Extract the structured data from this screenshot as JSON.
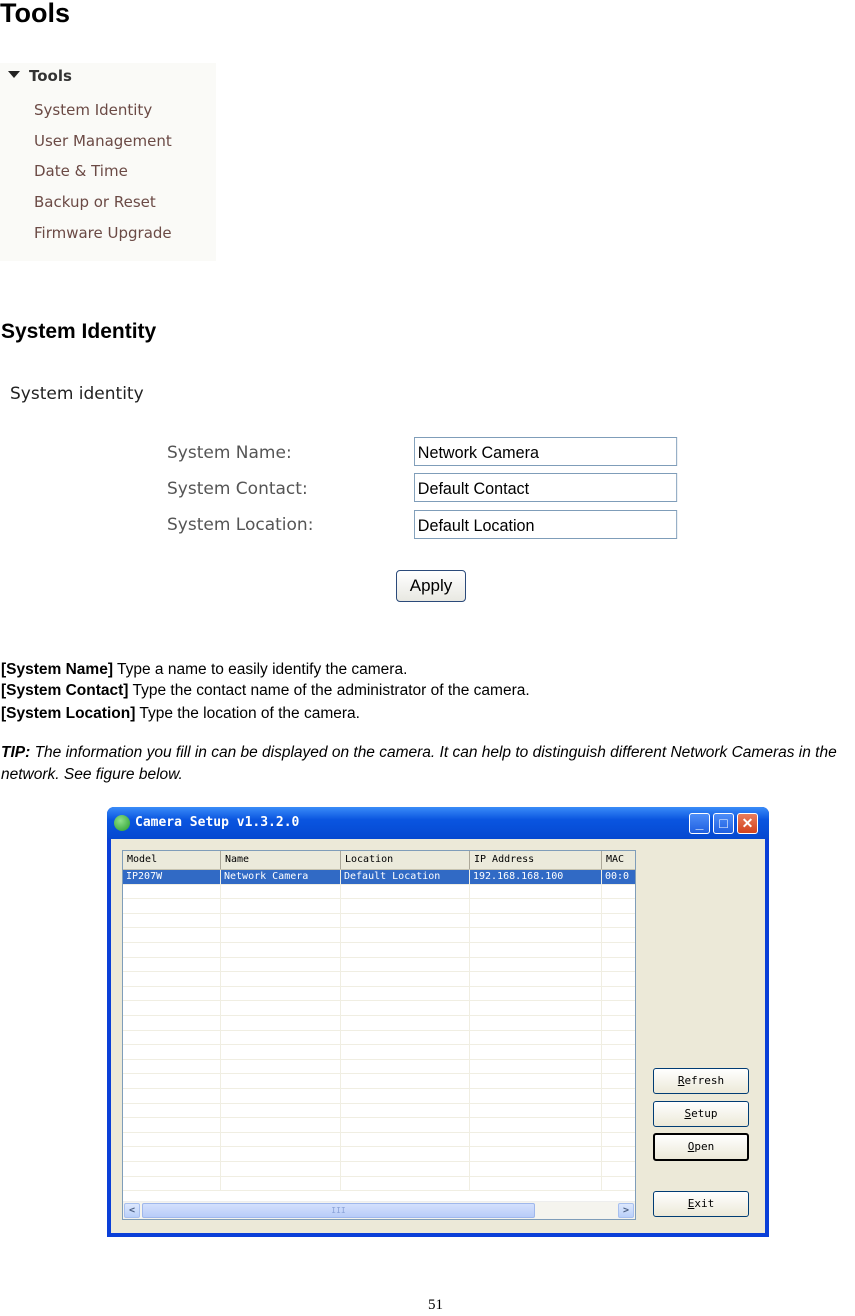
{
  "heading_tools": "Tools",
  "nav": {
    "header": "Tools",
    "items": [
      "System Identity",
      "User Management",
      "Date & Time",
      "Backup or Reset",
      "Firmware Upgrade"
    ]
  },
  "heading_system_identity": "System Identity",
  "form": {
    "title": "System identity",
    "fields": [
      {
        "label": "System Name:",
        "value": "Network Camera"
      },
      {
        "label": "System Contact:",
        "value": "Default Contact"
      },
      {
        "label": "System Location:",
        "value": "Default Location"
      }
    ],
    "apply_label": "Apply"
  },
  "descriptions": [
    {
      "term": "[System Name]",
      "text": " Type a name to easily identify the camera."
    },
    {
      "term": "[System Contact]",
      "text": " Type the contact name of the administrator of the camera."
    },
    {
      "term": "[System Location]",
      "text": " Type the location of the camera."
    }
  ],
  "tip": {
    "label": "TIP:",
    "text": " The information you fill in can be displayed on the camera. It can help to distinguish different Network Cameras in the network. See figure below."
  },
  "camera_setup": {
    "title": "Camera Setup v1.3.2.0",
    "window_buttons": {
      "minimize": "_",
      "maximize": "□",
      "close": "✕"
    },
    "columns": [
      "Model",
      "Name",
      "Location",
      "IP Address",
      "MAC"
    ],
    "rows": [
      [
        "IP207W",
        "Network Camera",
        "Default Location",
        "192.168.168.100",
        "00:0"
      ]
    ],
    "empty_rows": 21,
    "scroll_left": "<",
    "scroll_right": ">",
    "scroll_grip": "III",
    "buttons": [
      {
        "accel": "R",
        "rest": "efresh"
      },
      {
        "accel": "S",
        "rest": "etup"
      },
      {
        "accel": "O",
        "rest": "pen"
      },
      {
        "accel": "E",
        "rest": "xit"
      }
    ]
  },
  "page_number": "51"
}
